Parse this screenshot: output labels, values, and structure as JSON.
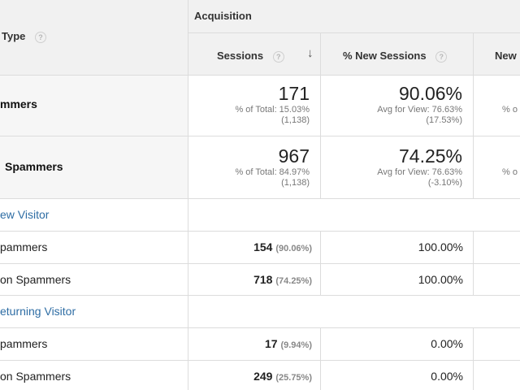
{
  "header": {
    "type_label": "Type",
    "group_label": "Acquisition",
    "columns": [
      "Sessions",
      "% New Sessions",
      "New U"
    ],
    "help_glyph": "?",
    "sort_glyph": "↓"
  },
  "segments": [
    {
      "name": "mmers",
      "sessions": "171",
      "sessions_total": "% of Total: 15.03%",
      "sessions_total_abs": "(1,138)",
      "new_sessions": "90.06%",
      "new_avg": "Avg for View: 76.63%",
      "new_delta": "(17.53%)",
      "new_users_sub": "% o"
    },
    {
      "name": "Spammers",
      "sessions": "967",
      "sessions_total": "% of Total: 84.97%",
      "sessions_total_abs": "(1,138)",
      "new_sessions": "74.25%",
      "new_avg": "Avg for View: 76.63%",
      "new_delta": "(-3.10%)",
      "new_users_sub": "% o"
    }
  ],
  "groups": [
    {
      "label": "ew Visitor",
      "rows": [
        {
          "label": "pammers",
          "sessions": "154",
          "pct": "(90.06%)",
          "new_sessions": "100.00%"
        },
        {
          "label": "on Spammers",
          "sessions": "718",
          "pct": "(74.25%)",
          "new_sessions": "100.00%"
        }
      ]
    },
    {
      "label": "eturning Visitor",
      "rows": [
        {
          "label": "pammers",
          "sessions": "17",
          "pct": "(9.94%)",
          "new_sessions": "0.00%"
        },
        {
          "label": "on Spammers",
          "sessions": "249",
          "pct": "(25.75%)",
          "new_sessions": "0.00%"
        }
      ]
    }
  ],
  "colors": {
    "link": "#2e6da4",
    "header_bg": "#f1f1f1",
    "border": "#dcdcdc"
  }
}
